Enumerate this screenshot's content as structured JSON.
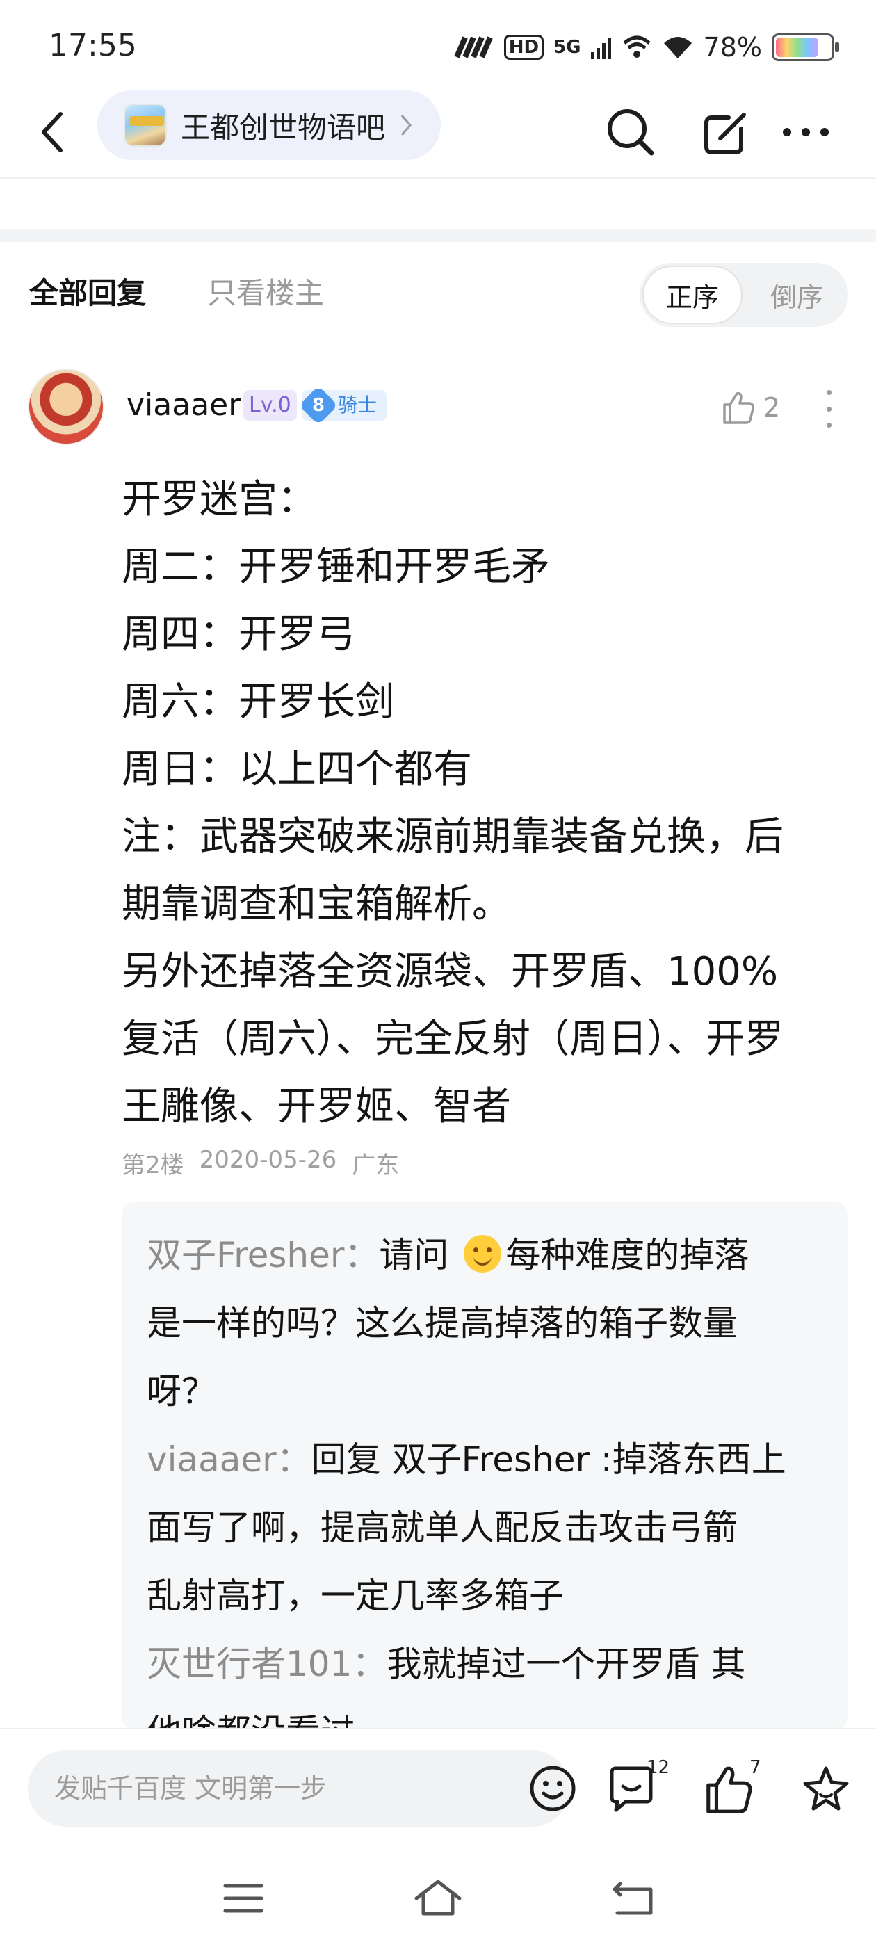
{
  "status_bar": {
    "time": "17:55",
    "network_labels": [
      "HD",
      "5G"
    ],
    "battery_percent": "78%",
    "battery_level": 0.78
  },
  "nav": {
    "forum_name": "王都创世物语吧",
    "icons": [
      "back-arrow-icon",
      "search-icon",
      "compose-icon",
      "more-icon"
    ]
  },
  "tabs": {
    "all_replies": "全部回复",
    "owner_only": "只看楼主",
    "sort_asc": "正序",
    "sort_desc": "倒序",
    "active_sort": "正序"
  },
  "post": {
    "username": "viaaaer",
    "level": "Lv.0",
    "badge_number": "8",
    "badge_title": "骑士",
    "like_count": "2",
    "lines": [
      "开罗迷宫：",
      "周二：开罗锤和开罗毛矛",
      "周四：开罗弓",
      "周六：开罗长剑",
      "周日：以上四个都有",
      "注：武器突破来源前期靠装备兑换，后",
      "期靠调查和宝箱解析。",
      "另外还掉落全资源袋、开罗盾、100%",
      "复活（周六）、完全反射（周日）、开罗",
      "王雕像、开罗姬、智者"
    ],
    "floor": "第2楼",
    "date": "2020-05-26",
    "location": "广东"
  },
  "sub_replies": {
    "lines": [
      {
        "name": "双子Fresher：",
        "text_before": "请问 ",
        "emoji": "smile-emoji",
        "text": "每种难度的掉落"
      },
      {
        "name": "",
        "text_before": "",
        "emoji": "",
        "text": "是一样的吗？这么提高掉落的箱子数量"
      },
      {
        "name": "",
        "text_before": "",
        "emoji": "",
        "text": "呀？"
      },
      {
        "name": "viaaaer：",
        "text_before": "",
        "emoji": "",
        "text": "回复 双子Fresher :掉落东西上"
      },
      {
        "name": "",
        "text_before": "",
        "emoji": "",
        "text": "面写了啊，提高就单人配反击攻击弓箭"
      },
      {
        "name": "",
        "text_before": "",
        "emoji": "",
        "text": "乱射高打，一定几率多箱子"
      },
      {
        "name": "灭世行者101：",
        "text_before": "",
        "emoji": "",
        "text": "我就掉过一个开罗盾 其"
      },
      {
        "name": "",
        "text_before": "",
        "emoji": "",
        "text": "他啥都没看过"
      }
    ]
  },
  "bottom_bar": {
    "input_placeholder": "发贴千百度 文明第一步",
    "comment_count": "12",
    "like_count": "7"
  },
  "system_nav": {
    "icons": [
      "menu-icon",
      "home-icon",
      "back-icon"
    ]
  },
  "colors": {
    "accent_blue": "#3a86e0",
    "level_purple": "#7b61d6",
    "muted_gray": "#9a9a9a"
  }
}
